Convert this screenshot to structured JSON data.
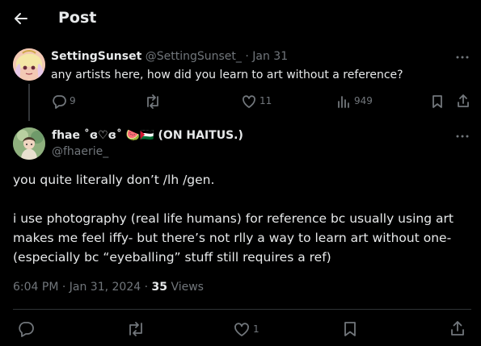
{
  "header": {
    "title": "Post"
  },
  "parent": {
    "display_name": "SettingSunset",
    "handle": "@SettingSunset_",
    "date": "· Jan 31",
    "text": "any artists here, how did you learn to art without a reference?",
    "replies": "9",
    "likes": "11",
    "views": "949"
  },
  "main": {
    "display_name": "fhae ˚ɞ♡ɞ˚ 🍉🇵🇸 (ON HAITUS.)",
    "handle": "@fhaerie_",
    "text_line1": "you quite literally don’t /lh /gen.",
    "text_line2": "i use photography (real life humans) for reference bc usually using art",
    "text_line3": "makes me feel iffy- but there’s not rlly a way to learn art without one-",
    "text_line4": "(especially bc “eyeballing” stuff still requires a ref)",
    "timestamp": "6:04 PM · Jan 31, 2024 ·",
    "views_count": "35",
    "views_label": "Views",
    "likes": "1"
  },
  "colors": {
    "background": "#000000",
    "text": "#e7e9ea",
    "muted": "#71767b",
    "divider": "#2f3336"
  },
  "icons": [
    "back-arrow-icon",
    "more-icon",
    "reply-icon",
    "retweet-icon",
    "like-icon",
    "views-icon",
    "bookmark-icon",
    "share-icon"
  ]
}
